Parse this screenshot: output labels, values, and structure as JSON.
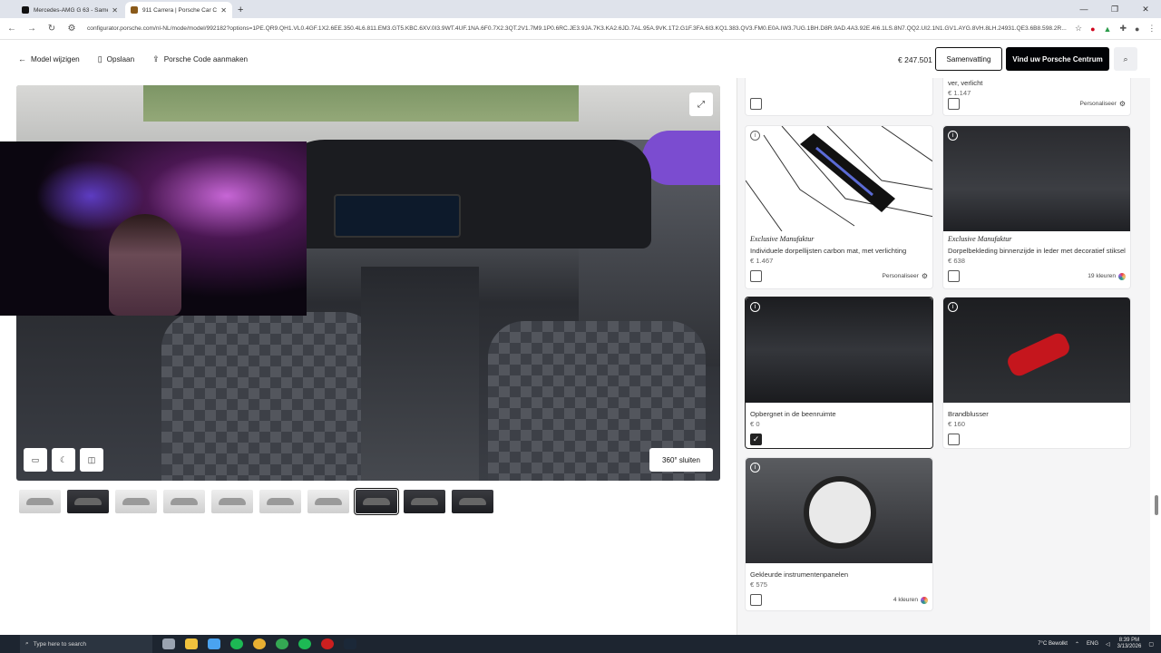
{
  "browser": {
    "tabs": [
      {
        "title": "Mercedes-AMG G 63 - Samen...",
        "active": false
      },
      {
        "title": "911 Carrera | Porsche Car Confi...",
        "active": true
      }
    ],
    "new_tab": "+",
    "window_controls": [
      "—",
      "❐",
      "✕"
    ],
    "url": "configurator.porsche.com/nl-NL/mode/model/992182?options=1PE.QR9.QH1.VL0.4GF.1X2.6EE.350.4L6.811.EM3.GT5.KBC.6XV.0I3.9WT.4UF.1NA.6F0.7X2.3QT.2V1.7M9.1P0.6RC.JE3.9JA.7K3.KA2.6JD.7AL.95A.9VK.1T2.G1F.3FA.6I3.KQ1.383.QV3.FM0.E0A.IW3.7UG.1BH.D8R.9AD.4A3.92E.4I6.1LS.8N7.QQ2.UI2.1N1.GV1.AYG.8VH.8LH.24931.QE3.6B8.598.2R..."
  },
  "header": {
    "model_change": "Model wijzigen",
    "save": "Opslaan",
    "porsche_code": "Porsche Code aanmaken",
    "total_price": "€ 247.501",
    "summary_btn": "Samenvatting",
    "find_centre_btn": "Vind uw Porsche Centrum",
    "search_icon": "search-icon"
  },
  "viewer": {
    "close_360": "360° sluiten",
    "controls": [
      "image-icon",
      "moon-icon",
      "camera-icon"
    ],
    "thumbnails": [
      {
        "dark": false,
        "selected": false
      },
      {
        "dark": true,
        "selected": false
      },
      {
        "dark": false,
        "selected": false
      },
      {
        "dark": false,
        "selected": false
      },
      {
        "dark": false,
        "selected": false
      },
      {
        "dark": false,
        "selected": false
      },
      {
        "dark": false,
        "selected": false
      },
      {
        "dark": true,
        "selected": true
      },
      {
        "dark": true,
        "selected": false
      },
      {
        "dark": true,
        "selected": false
      }
    ]
  },
  "panel": {
    "top_cards": [
      {
        "name": "",
        "price": "",
        "checked": false,
        "meta": ""
      },
      {
        "name": "ver, verlicht",
        "price": "€ 1.147",
        "checked": false,
        "meta": "Personaliseer"
      }
    ],
    "cards": [
      {
        "brand": "Exclusive Manufaktur",
        "name": "Individuele dorpellijsten carbon mat, met verlichting",
        "price": "€ 1.467",
        "checked": false,
        "meta": "Personaliseer",
        "meta_kind": "gear"
      },
      {
        "brand": "Exclusive Manufaktur",
        "name": "Dorpelbekleding binnenzijde in leder met decoratief stiksel",
        "price": "€ 638",
        "checked": false,
        "meta": "19 kleuren",
        "meta_kind": "colors"
      },
      {
        "brand": "",
        "name": "Opbergnet in de beenruimte",
        "price": "€ 0",
        "checked": true,
        "meta": "",
        "meta_kind": ""
      },
      {
        "brand": "",
        "name": "Brandblusser",
        "price": "€ 160",
        "checked": false,
        "meta": "",
        "meta_kind": ""
      },
      {
        "brand": "",
        "name": "Gekleurde instrumentenpanelen",
        "price": "€ 575",
        "checked": false,
        "meta": "4 kleuren",
        "meta_kind": "colors"
      }
    ]
  },
  "taskbar": {
    "search_placeholder": "Type here to search",
    "weather": "7°C  Bewolkt",
    "lang": "ENG",
    "time": "8:39 PM",
    "date": "3/13/2026"
  },
  "colors": {
    "accent": "#010205",
    "panel_bg": "#f5f5f6"
  }
}
